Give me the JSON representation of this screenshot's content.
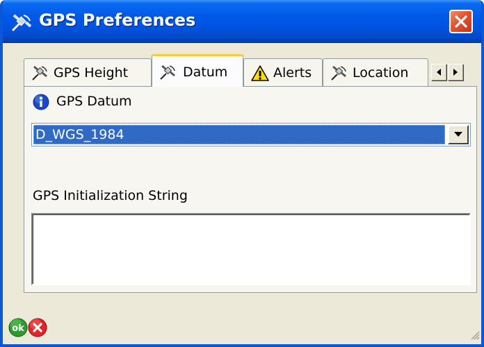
{
  "window": {
    "title": "GPS Preferences",
    "title_icon": "satellite-icon",
    "close_icon": "close-icon"
  },
  "tabs": [
    {
      "label": "GPS Height",
      "icon": "satellite-icon",
      "active": false
    },
    {
      "label": "Datum",
      "icon": "satellite-icon",
      "active": true
    },
    {
      "label": "Alerts",
      "icon": "warning-icon",
      "active": false
    },
    {
      "label": "Location",
      "icon": "satellite-icon",
      "active": false
    }
  ],
  "tab_scroll": {
    "left_icon": "arrow-left-icon",
    "right_icon": "arrow-right-icon"
  },
  "panel": {
    "datum_label": "GPS Datum",
    "datum_icon": "info-icon",
    "datum_value": "D_WGS_1984",
    "init_string_label": "GPS Initialization String",
    "init_string_value": ""
  },
  "footer": {
    "ok_label": "ok",
    "cancel_icon": "cancel-icon"
  },
  "colors": {
    "titlebar": "#0054e3",
    "window_bg": "#ece9d8",
    "selection": "#316ac5",
    "close_button": "#e2532f",
    "ok_button": "#2e9b2e",
    "cancel_button": "#e0262b",
    "active_tab_accent": "#ffc83c"
  }
}
